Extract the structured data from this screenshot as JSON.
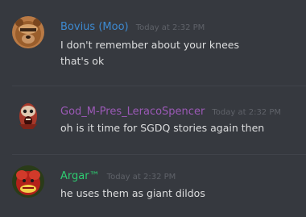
{
  "messages": [
    {
      "author": "Bovius (Moo)",
      "author_color": "#3d8ad1",
      "timestamp": "Today at 2:32 PM",
      "avatar_icon": "bear-avatar-icon",
      "lines": [
        "I don't remember about your knees",
        "that's ok"
      ]
    },
    {
      "author": "God_M-Pres_LeracoSpencer",
      "author_color": "#9b59b6",
      "timestamp": "Today at 2:32 PM",
      "avatar_icon": "zombie-face-avatar-icon",
      "lines": [
        "oh is it time for SGDQ stories again then"
      ]
    },
    {
      "author": "Argar™",
      "author_color": "#2ecc71",
      "timestamp": "Today at 2:32 PM",
      "avatar_icon": "red-creature-avatar-icon",
      "lines": [
        "he uses them as giant dildos"
      ]
    }
  ]
}
